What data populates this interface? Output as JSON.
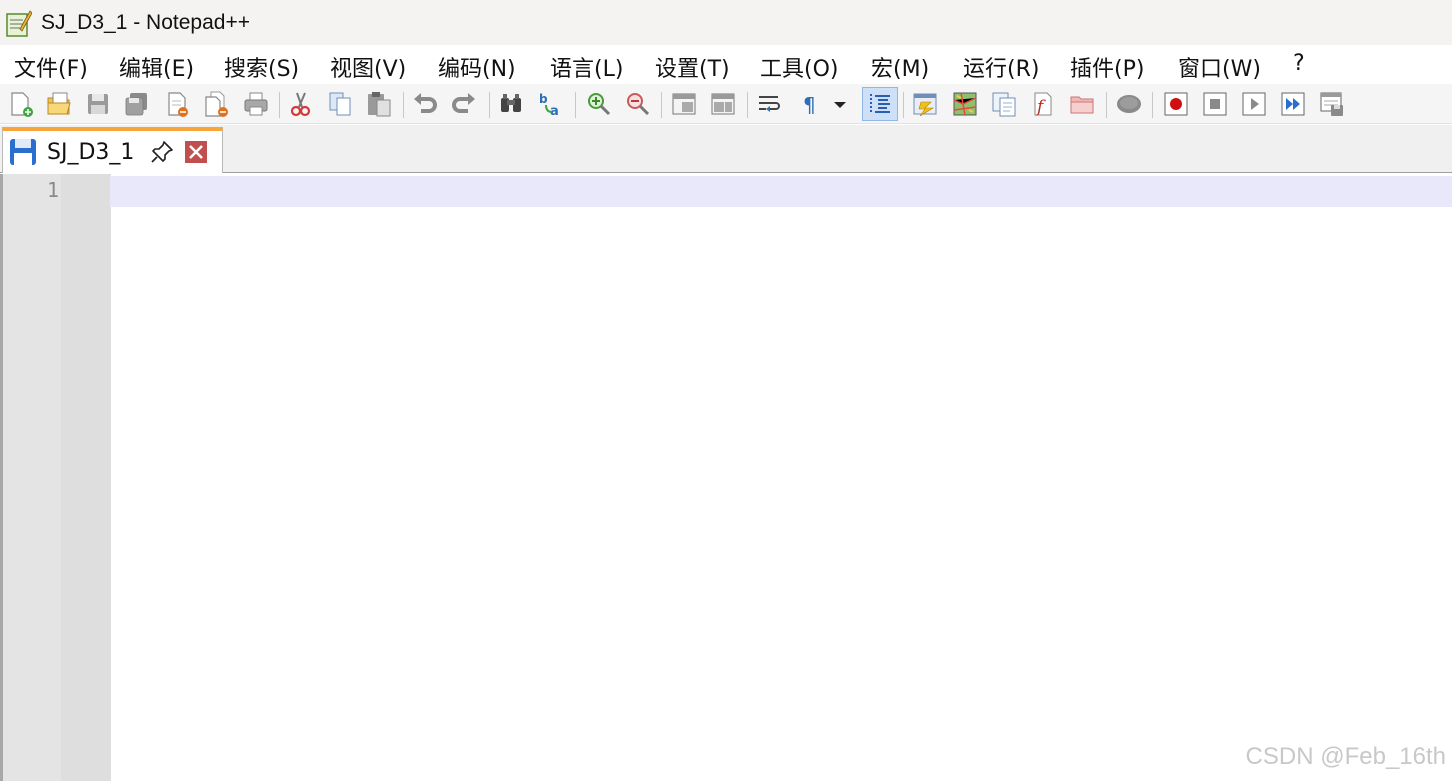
{
  "window": {
    "title": "SJ_D3_1 - Notepad++"
  },
  "menu": {
    "items": [
      {
        "label": "文件(F)"
      },
      {
        "label": "编辑(E)"
      },
      {
        "label": "搜索(S)"
      },
      {
        "label": "视图(V)"
      },
      {
        "label": "编码(N)"
      },
      {
        "label": "语言(L)"
      },
      {
        "label": "设置(T)"
      },
      {
        "label": "工具(O)"
      },
      {
        "label": "宏(M)"
      },
      {
        "label": "运行(R)"
      },
      {
        "label": "插件(P)"
      },
      {
        "label": "窗口(W)"
      },
      {
        "label": "?"
      }
    ]
  },
  "toolbar": {
    "icons": [
      "new-file-icon",
      "open-file-icon",
      "save-icon",
      "save-all-icon",
      "close-icon",
      "close-all-icon",
      "print-icon",
      "cut-icon",
      "copy-icon",
      "paste-icon",
      "undo-icon",
      "redo-icon",
      "find-icon",
      "replace-icon",
      "zoom-in-icon",
      "zoom-out-icon",
      "sync-vertical-icon",
      "sync-horizontal-icon",
      "word-wrap-icon",
      "show-all-chars-icon",
      "dropdown-icon",
      "indent-guide-icon",
      "user-defined-language-icon",
      "document-map-icon",
      "document-list-icon",
      "function-list-icon",
      "folder-as-workspace-icon",
      "monitoring-icon",
      "record-macro-icon",
      "stop-macro-icon",
      "play-macro-icon",
      "run-macro-multiple-icon",
      "save-macro-icon"
    ]
  },
  "tabs": [
    {
      "label": "SJ_D3_1",
      "active": true
    }
  ],
  "editor": {
    "line_numbers": [
      "1"
    ],
    "content": ""
  },
  "watermark": "CSDN @Feb_16th",
  "colors": {
    "tab_accent": "#f7a43a",
    "current_line": "#e8e8fa",
    "close_button": "#c0504d"
  }
}
